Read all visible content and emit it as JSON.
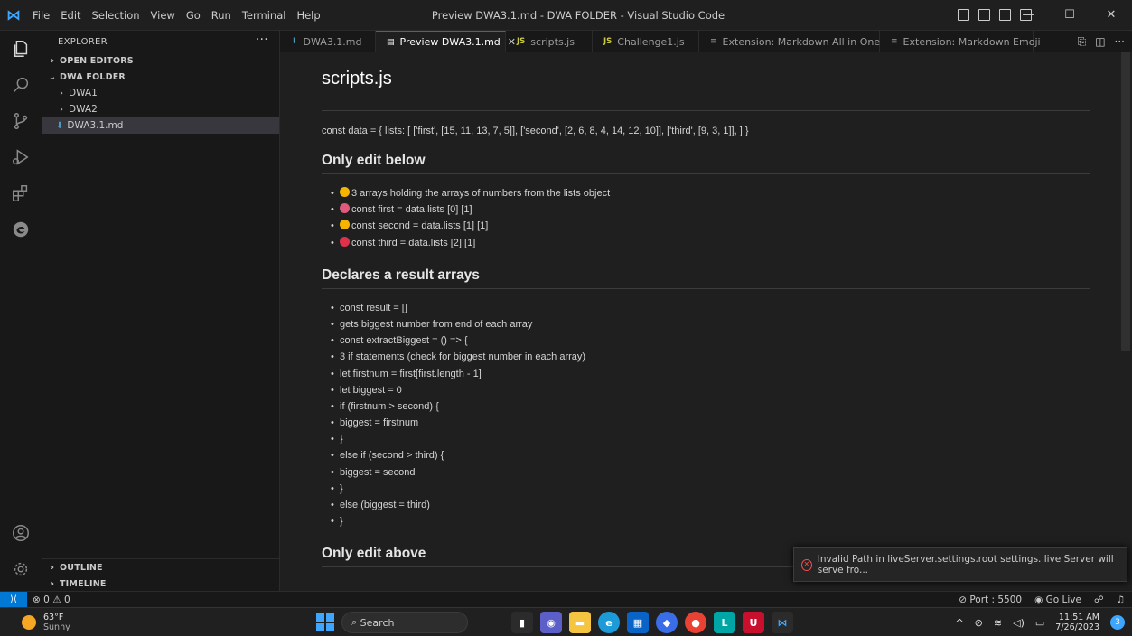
{
  "titlebar": {
    "menu": [
      "File",
      "Edit",
      "Selection",
      "View",
      "Go",
      "Run",
      "Terminal",
      "Help"
    ],
    "title": "Preview DWA3.1.md - DWA FOLDER - Visual Studio Code",
    "controls": {
      "minimize": "—",
      "maximize": "☐",
      "close": "✕"
    }
  },
  "sidebar": {
    "header": "EXPLORER",
    "more": "···",
    "open_editors": "OPEN EDITORS",
    "folder": "DWA FOLDER",
    "items": [
      {
        "label": "DWA1",
        "type": "folder"
      },
      {
        "label": "DWA2",
        "type": "folder"
      },
      {
        "label": "DWA3.1.md",
        "type": "file"
      }
    ],
    "outline": "OUTLINE",
    "timeline": "TIMELINE"
  },
  "tabs": [
    {
      "label": "DWA3.1.md",
      "icon": "markdown-icon",
      "active": false
    },
    {
      "label": "Preview DWA3.1.md",
      "icon": "preview-icon",
      "active": true
    },
    {
      "label": "scripts.js",
      "icon": "js-icon",
      "active": false
    },
    {
      "label": "Challenge1.js",
      "icon": "js-icon",
      "active": false
    },
    {
      "label": "Extension: Markdown All in One",
      "icon": "extension-icon",
      "active": false
    },
    {
      "label": "Extension: Markdown Emoji",
      "icon": "extension-icon",
      "active": false
    }
  ],
  "icon_labels": {
    "js": "JS",
    "close": "✕"
  },
  "doc": {
    "title": "scripts.js",
    "const_line": "const data = { lists: [ ['first', [15, 11, 13, 7, 5]], ['second', [2, 6, 8, 4, 14, 12, 10]], ['third', [9, 3, 1]], ] }",
    "h_edit_below": "Only edit below",
    "list1": [
      {
        "text": "3 arrays holding the arrays of numbers from the lists object",
        "emoji_color": "#f5b400"
      },
      {
        "text": "const first = data.lists [0] [1]",
        "emoji_color": "#e05a7a"
      },
      {
        "text": "const second = data.lists [1] [1]",
        "emoji_color": "#f5b400"
      },
      {
        "text": "const third = data.lists [2] [1]",
        "emoji_color": "#e0304a"
      }
    ],
    "h_declares": "Declares a result arrays",
    "list2": [
      "const result = []",
      "gets biggest number from end of each array",
      "const extractBiggest = () => {",
      "3 if statements (check for biggest number in each array)",
      "let firstnum = first[first.length - 1]",
      "let biggest = 0",
      "if (firstnum > second) {",
      "biggest = firstnum",
      "}",
      "else if (second > third) {",
      "biggest = second",
      "}",
      "else (biggest = third)",
      "}"
    ],
    "h_edit_above": "Only edit above"
  },
  "notification": {
    "text": "Invalid Path in liveServer.settings.root settings. live Server will serve fro..."
  },
  "statusbar": {
    "errors": "0",
    "warnings": "0",
    "port": "Port : 5500",
    "golive": "Go Live"
  },
  "taskbar": {
    "temp": "63°F",
    "weather": "Sunny",
    "search": "Search",
    "time": "11:51 AM",
    "date": "7/26/2023",
    "badge": "3"
  },
  "colors": {
    "accent": "#0078d4",
    "error": "#f14c4c",
    "js": "#cbcb41",
    "markdown": "#519aba"
  }
}
